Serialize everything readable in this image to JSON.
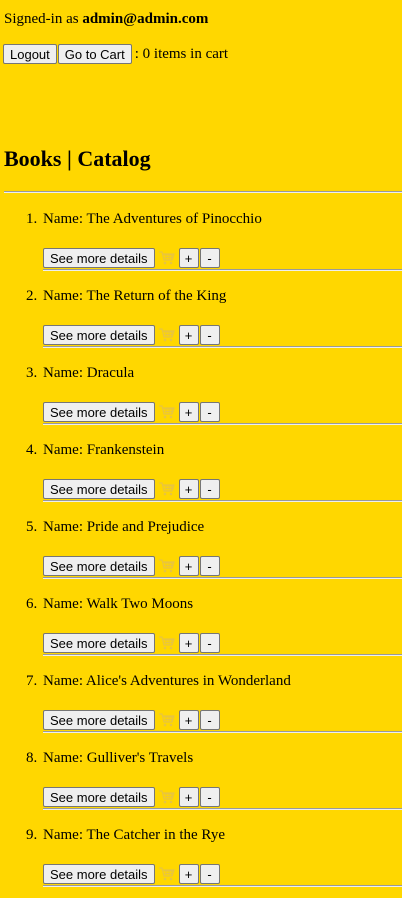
{
  "header": {
    "signed_in_prefix": "Signed-in as ",
    "user": "admin@admin.com",
    "logout_label": "Logout",
    "cart_label": "Go to Cart",
    "cart_count_text": ": 0 items in cart"
  },
  "catalog": {
    "title": "Books | Catalog",
    "details_label": "See more details",
    "plus_label": "+",
    "minus_label": "-",
    "name_prefix": "Name: ",
    "books": [
      {
        "num": "1.",
        "name": "The Adventures of Pinocchio"
      },
      {
        "num": "2.",
        "name": "The Return of the King"
      },
      {
        "num": "3.",
        "name": "Dracula"
      },
      {
        "num": "4.",
        "name": "Frankenstein"
      },
      {
        "num": "5.",
        "name": "Pride and Prejudice"
      },
      {
        "num": "6.",
        "name": "Walk Two Moons"
      },
      {
        "num": "7.",
        "name": "Alice's Adventures in Wonderland"
      },
      {
        "num": "8.",
        "name": "Gulliver's Travels"
      },
      {
        "num": "9.",
        "name": "The Catcher in the Rye"
      }
    ]
  },
  "colors": {
    "background": "#FFD700"
  },
  "icons": {
    "cart": "shopping-cart-icon"
  }
}
